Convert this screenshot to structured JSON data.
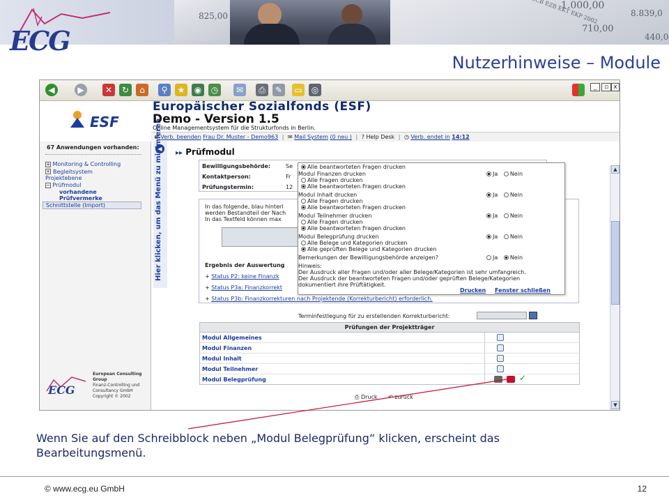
{
  "slide": {
    "title": "Nutzerhinweise – Module",
    "logo_text": "ECG",
    "caption": "Wenn Sie auf den Schreibblock neben „Modul Belegprüfung“ klicken, erscheint das Bearbeitungsmenü.",
    "footer_left": "© www.ecg.eu GmbH",
    "page_number": "12",
    "banner_numbers": [
      "825,00",
      "1.000,00",
      "8.839,0",
      "710,00",
      "440,0"
    ],
    "banner_ticket": "ECB EZB EKT EKP 2002"
  },
  "browser": {
    "header": {
      "logo": "ESF",
      "title": "Europäischer Sozialfonds (ESF)",
      "subtitle": "Demo - Version 1.5",
      "tagline": "Online Managementsystem für die Strukturfonds in Berlin."
    },
    "navbar": {
      "logout": "Verb. beenden",
      "user": "Frau Dr. Muster - Demo963",
      "mail": "Mail System",
      "mail_count": "(0 neu )",
      "help": "Help Desk",
      "session": "Verb. endet in",
      "session_time": "14:12"
    },
    "sidebar": {
      "count": "67 Anwendungen vorhanden:",
      "items": [
        {
          "label": "Monitoring & Controlling"
        },
        {
          "label": "Begleitsystem Projektebene"
        },
        {
          "label": "Prüfmodul"
        }
      ],
      "sub_items": [
        "vorhandene Prüfvermerke"
      ],
      "active": "Schnittstelle (Import)",
      "company": "European Consulting Group",
      "company_sub1": "Finanz-Controlling und",
      "company_sub2": "Consultancy GmbH",
      "copyright": "Copyright © 2002"
    },
    "side_tab": "Hier klicken, um das Menü zu minimieren",
    "content": {
      "title": "Prüfmodul",
      "info_labels": [
        "Bewilligungsbehörde:",
        "Kontaktperson:",
        "Prüfungstermin:"
      ],
      "info_values": [
        "Se",
        "Fr",
        "12"
      ],
      "text_lines": [
        "In das folgende, blau hinterl",
        "werden Bestandteil der Nach",
        "In das Textfeld können max"
      ],
      "result_title": "Ergebnis der Auswertung",
      "status_links": [
        "Status P2: keine Finanzk",
        "Status P3a: Finanzkorrekt",
        "Status P3b: Finanzkorrekturen nach Projektende (Korrekturbericht) erforderlich."
      ],
      "deadline_label": "Terminfestlegung für zu erstellenden Korrekturbericht:"
    },
    "popup": {
      "sections": [
        {
          "heading": "",
          "options": [
            "Alle beantworteten Fragen drucken"
          ],
          "selected": 0,
          "yes": null
        },
        {
          "heading": "Modul Finanzen drucken",
          "options": [
            "Alle Fragen drucken",
            "Alle beantworteten Fragen drucken"
          ],
          "selected": 1,
          "yes": true
        },
        {
          "heading": "Modul Inhalt drucken",
          "options": [
            "Alle Fragen drucken",
            "Alle beantworteten Fragen drucken"
          ],
          "selected": 1,
          "yes": true
        },
        {
          "heading": "Modul Teilnehmer drucken",
          "options": [
            "Alle Fragen drucken",
            "Alle beantworteten Fragen drucken"
          ],
          "selected": 1,
          "yes": true
        },
        {
          "heading": "Modul Belegprüfung drucken",
          "options": [
            "Alle Belege und Kategorien drucken",
            "Alle geprüften Belege und Kategorien drucken"
          ],
          "selected": 1,
          "yes": true
        }
      ],
      "remarks": "Bemerkungen der Bewilligungsbehörde anzeigen?",
      "yes_label": "Ja",
      "no_label": "Nein",
      "hint_title": "Hinweis:",
      "hint_lines": [
        "Der Ausdruck aller Fragen und/oder aller Belege/Kategorien ist sehr umfangreich.",
        "Der Ausdruck der beantworteten Fragen und/oder geprüften Belege/Kategorien",
        "dokumentiert ihre Prüftätigkeit."
      ],
      "print": "Drucken",
      "close": "Fenster schließen"
    },
    "table": {
      "title": "Prüfungen der Projektträger",
      "rows": [
        "Modul Allgemeines",
        "Modul Finanzen",
        "Modul Inhalt",
        "Modul Teilnehmer",
        "Modul Belegprüfung"
      ]
    },
    "bottom_buttons": {
      "print": "Druck",
      "back": "zurück"
    },
    "colors": {
      "accent_blue": "#1c3d9b",
      "title_blue": "#2b3f96",
      "annotation_red": "#c8102e",
      "check_green": "#2a9a2a"
    }
  }
}
